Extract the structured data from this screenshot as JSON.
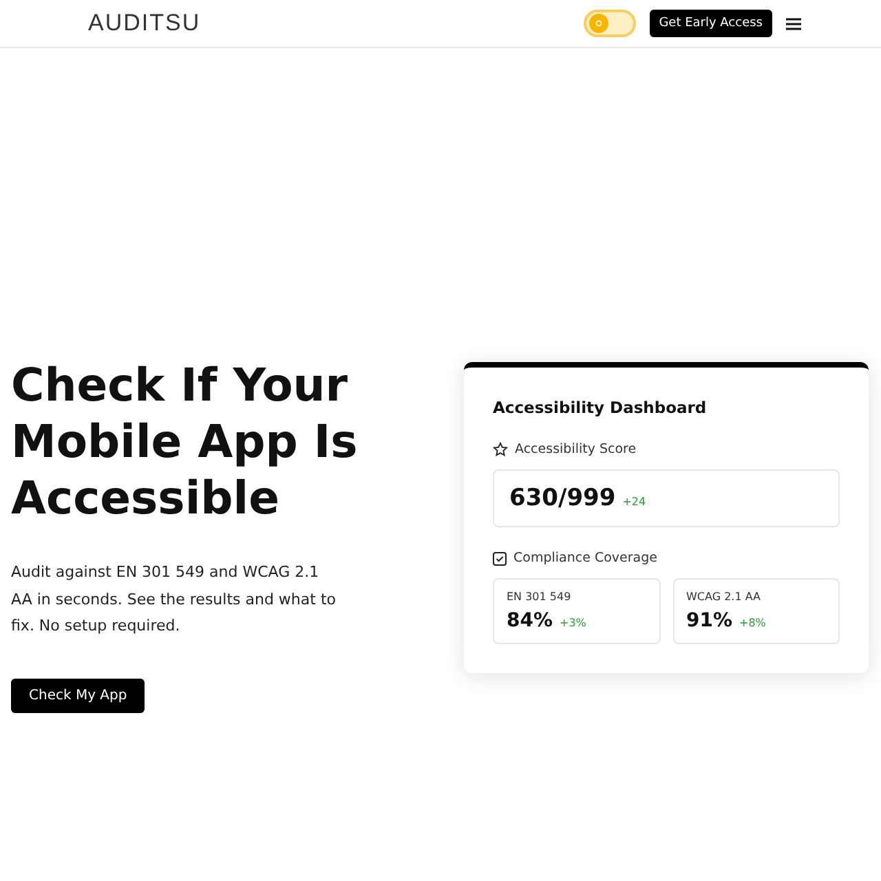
{
  "header": {
    "logo": "AUDITSU",
    "theme_toggle": {
      "dark": false
    },
    "cta": "Get Early Access"
  },
  "hero": {
    "title": "Check If Your Mobile App Is Accessible",
    "description": "Audit against EN 301 549 and WCAG 2.1 AA in seconds. See the results and what to fix. No setup required.",
    "button": "Check My App"
  },
  "dashboard": {
    "title": "Accessibility Dashboard",
    "score_label": "Accessibility Score",
    "score": "630/999",
    "score_change": "+24",
    "coverage_label": "Compliance Coverage",
    "coverage": [
      {
        "name": "EN 301 549",
        "value": "84%",
        "change": "+3%"
      },
      {
        "name": "WCAG 2.1 AA",
        "value": "91%",
        "change": "+8%"
      }
    ]
  }
}
